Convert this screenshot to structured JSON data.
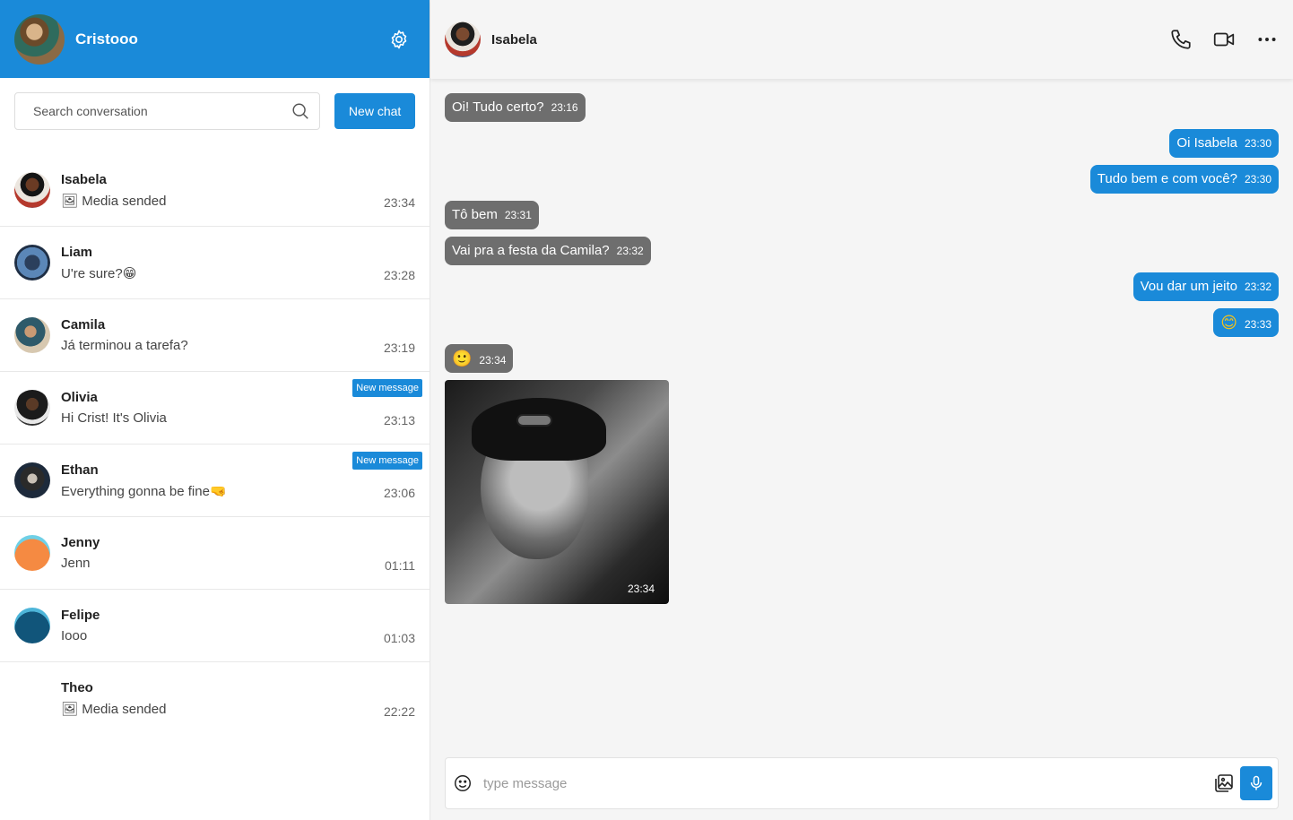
{
  "me": {
    "name": "Cristooo"
  },
  "search": {
    "placeholder": "Search conversation"
  },
  "new_chat_label": "New chat",
  "conversations": [
    {
      "name": "Isabela",
      "last": "🖼 Media sended",
      "time": "23:34",
      "badge": "",
      "avatar": "isabela"
    },
    {
      "name": "Liam",
      "last": "U're sure?😁",
      "time": "23:28",
      "badge": "",
      "avatar": "liam"
    },
    {
      "name": "Camila",
      "last": "Já terminou a tarefa?",
      "time": "23:19",
      "badge": "",
      "avatar": "camila"
    },
    {
      "name": "Olivia",
      "last": "Hi Crist! It's Olivia",
      "time": "23:13",
      "badge": "New message",
      "avatar": "olivia"
    },
    {
      "name": "Ethan",
      "last": "Everything gonna be fine🤜",
      "time": "23:06",
      "badge": "New message",
      "avatar": "ethan"
    },
    {
      "name": "Jenny",
      "last": "Jenn",
      "time": "01:11",
      "badge": "",
      "avatar": "jenny"
    },
    {
      "name": "Felipe",
      "last": "Iooo",
      "time": "01:03",
      "badge": "",
      "avatar": "felipe"
    },
    {
      "name": "Theo",
      "last": "🖼 Media sended",
      "time": "22:22",
      "badge": "",
      "avatar": "none"
    }
  ],
  "chat": {
    "contact_name": "Isabela",
    "messages": [
      {
        "dir": "in",
        "text": "Oi! Tudo certo?",
        "time": "23:16"
      },
      {
        "dir": "out",
        "text": "Oi Isabela",
        "time": "23:30"
      },
      {
        "dir": "out",
        "text": "Tudo bem e com você?",
        "time": "23:30"
      },
      {
        "dir": "in",
        "text": "Tô bem",
        "time": "23:31"
      },
      {
        "dir": "in",
        "text": "Vai pra a festa da Camila?",
        "time": "23:32"
      },
      {
        "dir": "out",
        "text": "Vou dar um jeito",
        "time": "23:32"
      },
      {
        "dir": "out",
        "text": "😊",
        "time": "23:33",
        "emoji": true
      },
      {
        "dir": "in",
        "text": "🙂",
        "time": "23:34",
        "emoji": true
      }
    ],
    "image_message": {
      "time": "23:34"
    },
    "composer_placeholder": "type message"
  },
  "colors": {
    "accent": "#1a8ad9",
    "incoming": "#6e6e6e"
  },
  "icons": [
    "gear-icon",
    "search-icon",
    "phone-icon",
    "video-icon",
    "more-icon",
    "emoji-icon",
    "gallery-icon",
    "mic-icon"
  ]
}
